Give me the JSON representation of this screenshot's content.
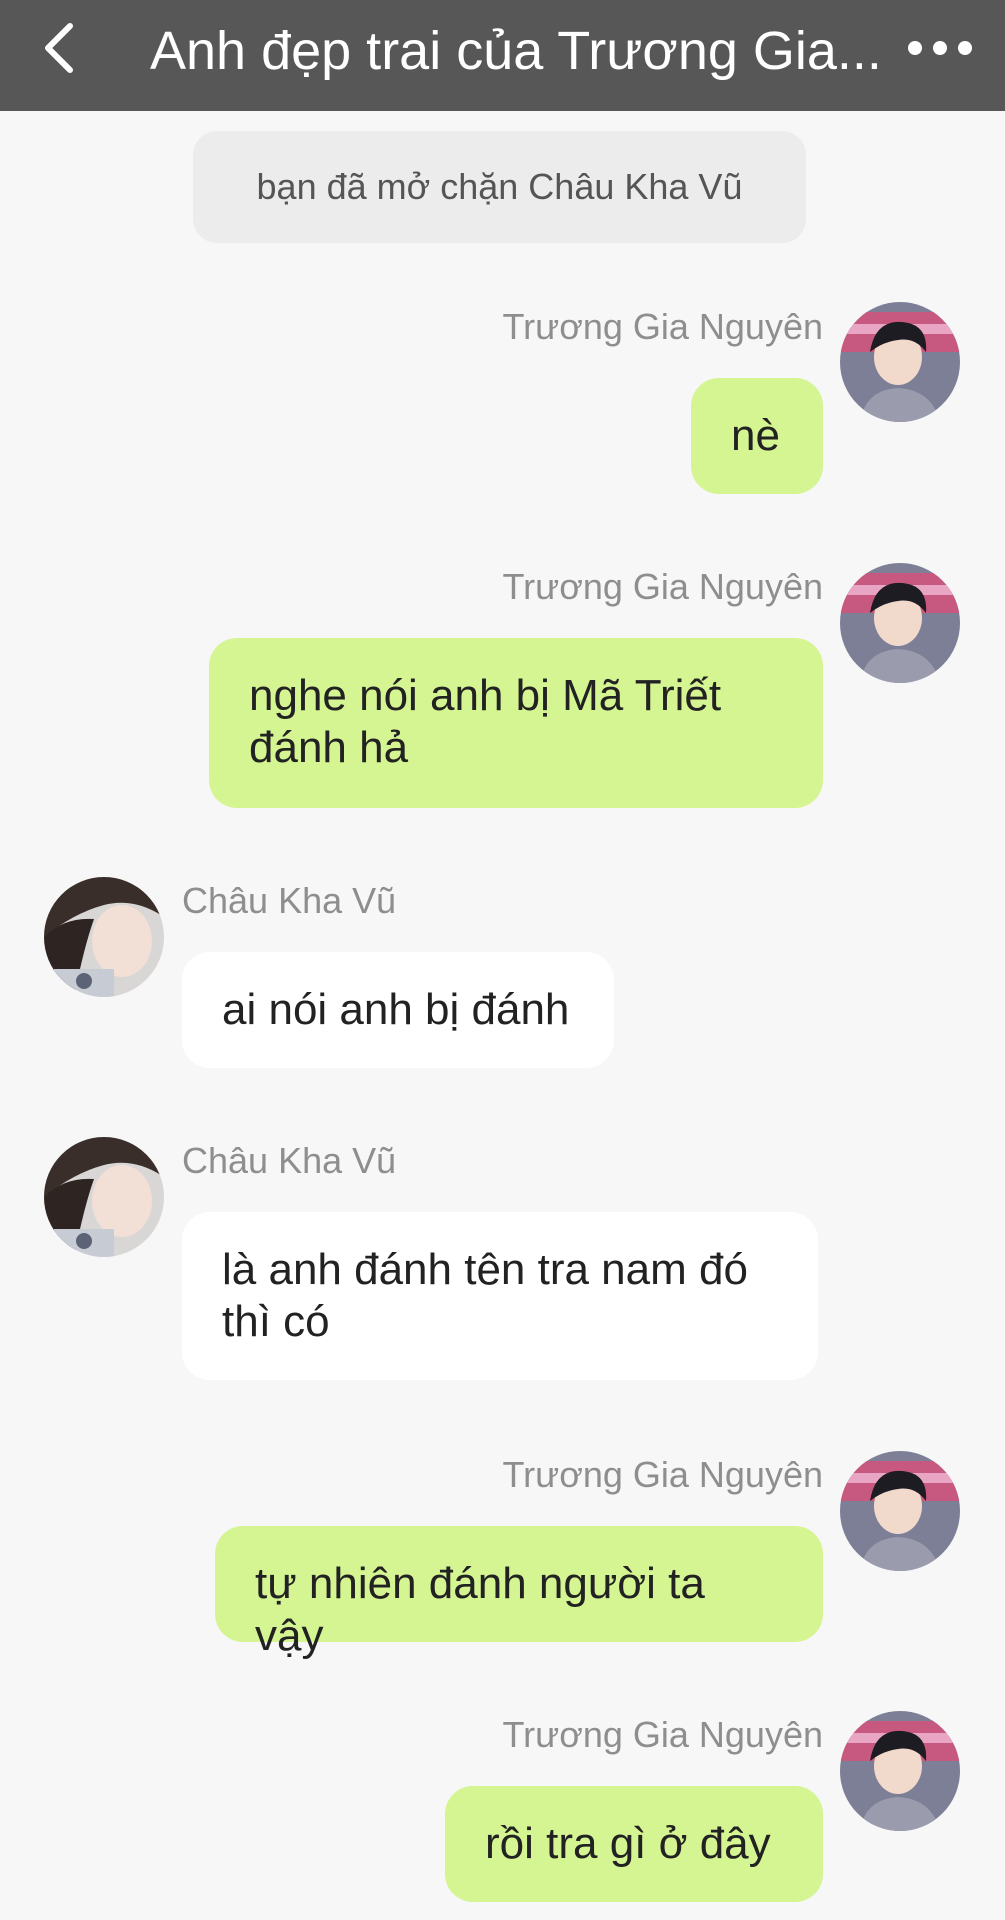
{
  "header": {
    "title": "Anh đẹp trai của Trương Gia...",
    "back_icon": "chevron-left-icon",
    "more_icon": "more-horizontal-icon"
  },
  "notice": "bạn đã mở chặn Châu Kha Vũ",
  "messages": [
    {
      "side": "right",
      "sender": "Trương Gia Nguyên",
      "text": "nè"
    },
    {
      "side": "right",
      "sender": "Trương Gia Nguyên",
      "text": "nghe nói anh bị Mã Triết đánh hả"
    },
    {
      "side": "left",
      "sender": "Châu Kha Vũ",
      "text": "ai nói anh bị đánh"
    },
    {
      "side": "left",
      "sender": "Châu Kha Vũ",
      "text": "là anh đánh tên tra nam đó thì có"
    },
    {
      "side": "right",
      "sender": "Trương Gia Nguyên",
      "text": "tự nhiên đánh người ta vậy"
    },
    {
      "side": "right",
      "sender": "Trương Gia Nguyên",
      "text": "rồi tra gì ở đây"
    }
  ],
  "colors": {
    "header_bg": "#575757",
    "outgoing_bubble": "#d4f592",
    "incoming_bubble": "#ffffff",
    "background": "#f7f7f7"
  }
}
